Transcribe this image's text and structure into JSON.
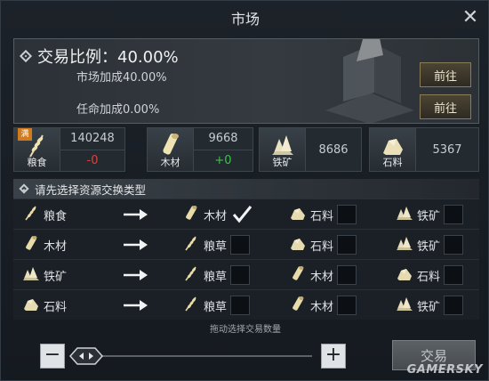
{
  "window": {
    "title": "市场"
  },
  "ratio": {
    "title": "交易比例：40.00%",
    "market_bonus": "市场加成40.00%",
    "appoint_bonus": "任命加成0.00%",
    "goto_label": "前往"
  },
  "resources": [
    {
      "name": "粮食",
      "icon": "grain-icon",
      "amount": "140248",
      "change": "-0",
      "badge": "满"
    },
    {
      "name": "木材",
      "icon": "wood-icon",
      "amount": "9668",
      "change": "+0"
    },
    {
      "name": "铁矿",
      "icon": "iron-ore-icon",
      "amount": "8686"
    },
    {
      "name": "石料",
      "icon": "stone-icon",
      "amount": "5367"
    }
  ],
  "section_header": "请先选择资源交换类型",
  "exchange_rows": [
    {
      "from": "粮食",
      "from_icon": "grain-icon",
      "targets": [
        {
          "label": "木材",
          "icon": "wood-icon",
          "checked": true
        },
        {
          "label": "石料",
          "icon": "stone-icon",
          "checked": false
        },
        {
          "label": "铁矿",
          "icon": "iron-ore-icon",
          "checked": false
        }
      ]
    },
    {
      "from": "木材",
      "from_icon": "wood-icon",
      "targets": [
        {
          "label": "粮草",
          "icon": "grain-icon",
          "checked": false
        },
        {
          "label": "石料",
          "icon": "stone-icon",
          "checked": false
        },
        {
          "label": "铁矿",
          "icon": "iron-ore-icon",
          "checked": false
        }
      ]
    },
    {
      "from": "铁矿",
      "from_icon": "iron-ore-icon",
      "targets": [
        {
          "label": "粮草",
          "icon": "grain-icon",
          "checked": false
        },
        {
          "label": "木材",
          "icon": "wood-icon",
          "checked": false
        },
        {
          "label": "石料",
          "icon": "stone-icon",
          "checked": false
        }
      ]
    },
    {
      "from": "石料",
      "from_icon": "stone-icon",
      "targets": [
        {
          "label": "粮草",
          "icon": "grain-icon",
          "checked": false
        },
        {
          "label": "木材",
          "icon": "wood-icon",
          "checked": false
        },
        {
          "label": "铁矿",
          "icon": "iron-ore-icon",
          "checked": false
        }
      ]
    }
  ],
  "hint": "拖动选择交易数量",
  "footer": {
    "minus_label": "−",
    "plus_label": "+",
    "trade_label": "交易"
  },
  "watermark": "GAMERSKY"
}
